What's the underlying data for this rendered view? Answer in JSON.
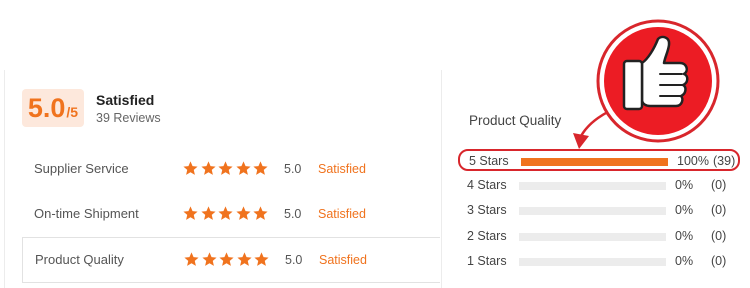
{
  "summary": {
    "score": "5.0",
    "score_max": "/5",
    "verdict": "Satisfied",
    "reviews": "39 Reviews"
  },
  "ratings": [
    {
      "label": "Supplier Service",
      "stars": 5,
      "score": "5.0",
      "verdict": "Satisfied"
    },
    {
      "label": "On-time Shipment",
      "stars": 5,
      "score": "5.0",
      "verdict": "Satisfied"
    },
    {
      "label": "Product Quality",
      "stars": 5,
      "score": "5.0",
      "verdict": "Satisfied"
    }
  ],
  "breakdown": {
    "title": "Product Quality",
    "rows": [
      {
        "label": "5  Stars",
        "percent": "100%",
        "count": "(39)",
        "fill": 1.0
      },
      {
        "label": "4  Stars",
        "percent": "0%",
        "count": "(0)",
        "fill": 0
      },
      {
        "label": "3  Stars",
        "percent": "0%",
        "count": "(0)",
        "fill": 0
      },
      {
        "label": "2  Stars",
        "percent": "0%",
        "count": "(0)",
        "fill": 0
      },
      {
        "label": "1  Stars",
        "percent": "0%",
        "count": "(0)",
        "fill": 0
      }
    ]
  },
  "colors": {
    "accent": "#f0731e",
    "highlight_red": "#d8262c",
    "badge_bg": "#ec1c24",
    "score_bg": "#fde8dc"
  },
  "icons": {
    "star": "star-icon",
    "badge": "thumbs-up-icon"
  }
}
